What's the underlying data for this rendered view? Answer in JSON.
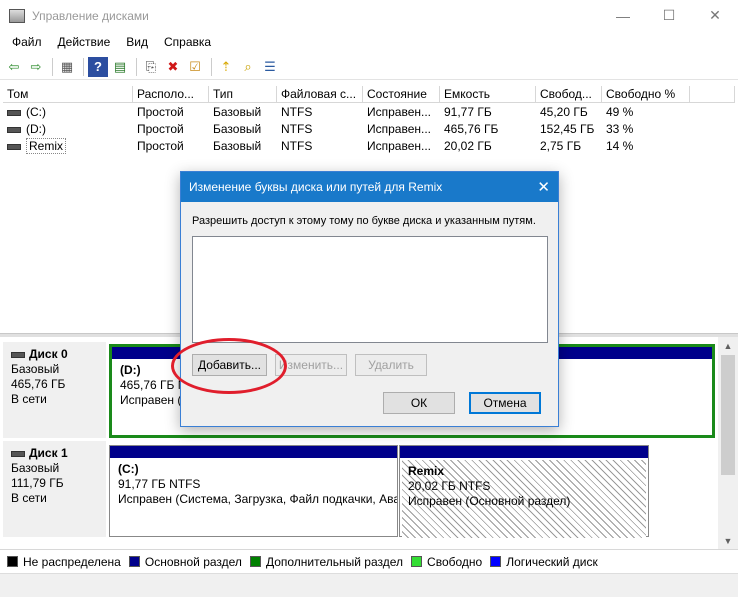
{
  "window": {
    "title": "Управление дисками",
    "controls": [
      "—",
      "☐",
      "✕"
    ]
  },
  "menu": [
    "Файл",
    "Действие",
    "Вид",
    "Справка"
  ],
  "toolbar": {
    "icons": [
      "back-arrow-icon",
      "forward-arrow-icon",
      "volume-list-icon",
      "help-icon",
      "properties-icon",
      "connect-icon",
      "delete-icon",
      "checklist-icon",
      "folder-up-icon",
      "search-icon",
      "details-icon"
    ],
    "glyphs": [
      "⇦",
      "⇨",
      "▦",
      "?",
      "▤",
      "⎘",
      "✖",
      "☑",
      "⇡",
      "⌕",
      "☰"
    ]
  },
  "volume_table": {
    "columns": [
      "Том",
      "Располо...",
      "Тип",
      "Файловая с...",
      "Состояние",
      "Емкость",
      "Свобод...",
      "Свободно %",
      ""
    ],
    "rows": [
      [
        "(C:)",
        "Простой",
        "Базовый",
        "NTFS",
        "Исправен...",
        "91,77 ГБ",
        "45,20 ГБ",
        "49 %"
      ],
      [
        "(D:)",
        "Простой",
        "Базовый",
        "NTFS",
        "Исправен...",
        "465,76 ГБ",
        "152,45 ГБ",
        "33 %"
      ],
      [
        "Remix",
        "Простой",
        "Базовый",
        "NTFS",
        "Исправен...",
        "20,02 ГБ",
        "2,75 ГБ",
        "14 %"
      ]
    ]
  },
  "disks": [
    {
      "name": "Диск 0",
      "type": "Базовый",
      "size": "465,76 ГБ",
      "status": "В сети",
      "partitions": [
        {
          "name": "(D:)",
          "info": "465,76 ГБ NTFS",
          "state": "Исправен (Основной раздел)"
        }
      ]
    },
    {
      "name": "Диск 1",
      "type": "Базовый",
      "size": "111,79 ГБ",
      "status": "В сети",
      "partitions": [
        {
          "name": "(C:)",
          "info": "91,77 ГБ NTFS",
          "state": "Исправен (Система, Загрузка, Файл подкачки, Аварийный дамп памяти)"
        },
        {
          "name": "Remix",
          "info": "20,02 ГБ NTFS",
          "state": "Исправен (Основной раздел)"
        }
      ]
    }
  ],
  "legend": [
    {
      "label": "Не распределена",
      "color": "#000000"
    },
    {
      "label": "Основной раздел",
      "color": "#00008b"
    },
    {
      "label": "Дополнительный раздел",
      "color": "#008000"
    },
    {
      "label": "Свободно",
      "color": "#33dd33"
    },
    {
      "label": "Логический диск",
      "color": "#0000ff"
    }
  ],
  "dialog": {
    "title": "Изменение буквы диска или путей для Remix",
    "description": "Разрешить доступ к этому тому по букве диска и указанным путям.",
    "add_label": "Добавить...",
    "change_label": "Изменить...",
    "delete_label": "Удалить",
    "ok_label": "ОК",
    "cancel_label": "Отмена"
  }
}
